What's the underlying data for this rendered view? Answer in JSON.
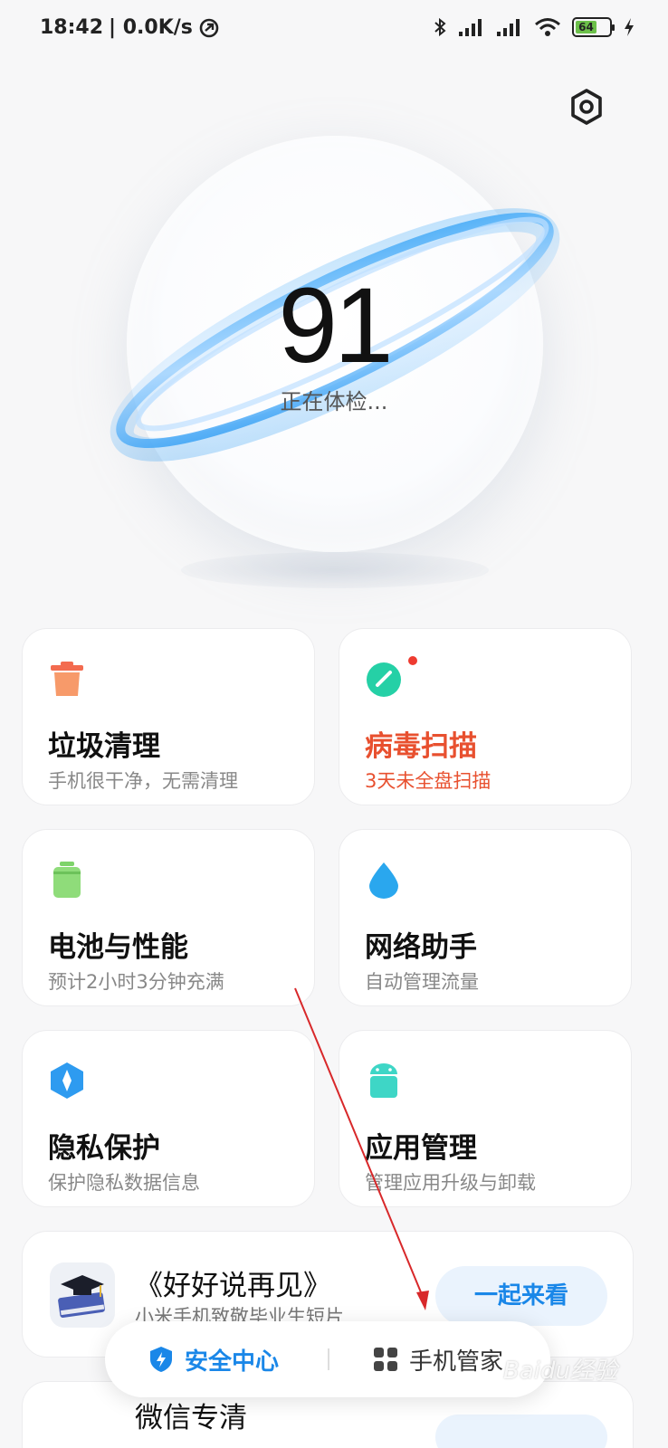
{
  "status_bar": {
    "time": "18:42",
    "net_speed": "| 0.0K/s",
    "battery_level": "64"
  },
  "header": {
    "settings_icon": "gear-icon"
  },
  "hero": {
    "score": "91",
    "status": "正在体检..."
  },
  "cards": [
    {
      "title": "垃圾清理",
      "subtitle": "手机很干净，无需清理",
      "icon": "trash-icon",
      "color": "#f36b4f",
      "alert": false
    },
    {
      "title": "病毒扫描",
      "subtitle": "3天未全盘扫描",
      "icon": "virus-scan-icon",
      "color": "#25d0a6",
      "alert": true
    },
    {
      "title": "电池与性能",
      "subtitle": "预计2小时3分钟充满",
      "icon": "battery-icon",
      "color": "#7ed36a",
      "alert": false
    },
    {
      "title": "网络助手",
      "subtitle": "自动管理流量",
      "icon": "water-drop-icon",
      "color": "#2aa7ee",
      "alert": false
    },
    {
      "title": "隐私保护",
      "subtitle": "保护隐私数据信息",
      "icon": "privacy-shield-icon",
      "color": "#2e9bf0",
      "alert": false
    },
    {
      "title": "应用管理",
      "subtitle": "管理应用升级与卸载",
      "icon": "android-icon",
      "color": "#3ed6c6",
      "alert": false
    }
  ],
  "promo": {
    "title": "《好好说再见》",
    "subtitle": "小米手机致敬毕业生短片",
    "button": "一起来看",
    "icon": "graduation-book-icon"
  },
  "promo2": {
    "title": "微信专清"
  },
  "tabbar": {
    "tab1": "安全中心",
    "tab2": "手机管家"
  },
  "watermark": "Baidu经验",
  "colors": {
    "accent": "#1a87e8",
    "alert": "#e8502f",
    "annotation": "#d8282a"
  }
}
